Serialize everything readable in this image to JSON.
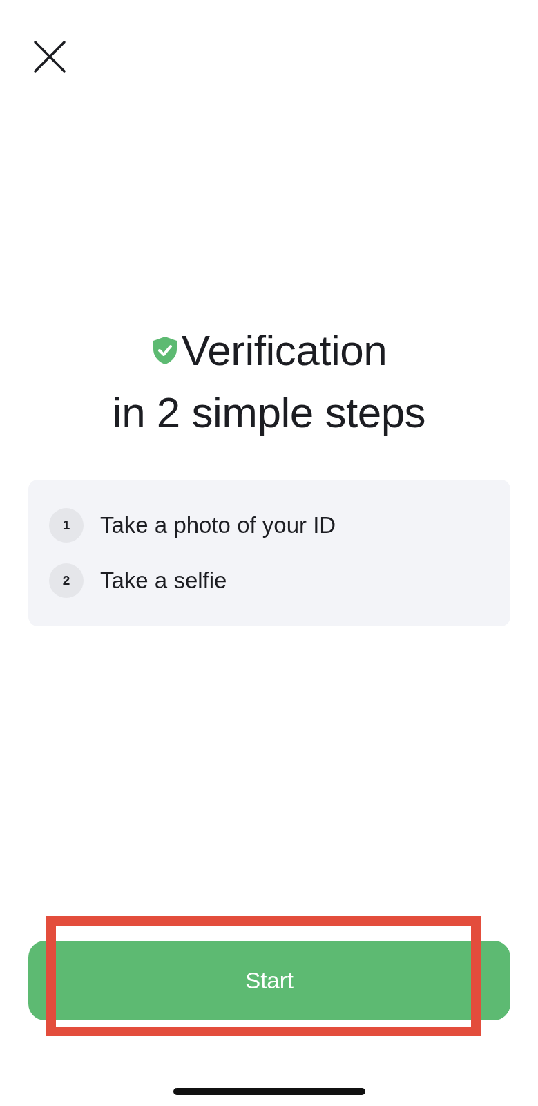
{
  "title": {
    "line_1": "Verification",
    "line_2": "in 2 simple steps"
  },
  "steps": [
    {
      "number": "1",
      "label": "Take a photo of your ID"
    },
    {
      "number": "2",
      "label": "Take a selfie"
    }
  ],
  "start_button": {
    "label": "Start",
    "highlighted": true
  }
}
